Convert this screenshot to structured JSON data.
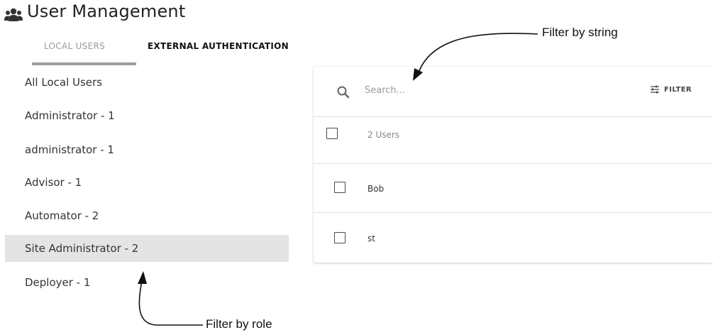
{
  "header": {
    "title": "User Management",
    "icon": "users-icon"
  },
  "tabs": [
    {
      "label": "LOCAL USERS",
      "active": true
    },
    {
      "label": "EXTERNAL AUTHENTICATION",
      "active": false
    }
  ],
  "roles": [
    {
      "label": "All Local Users",
      "selected": false
    },
    {
      "label": "Administrator - 1",
      "selected": false
    },
    {
      "label": "administrator - 1",
      "selected": false
    },
    {
      "label": "Advisor - 1",
      "selected": false
    },
    {
      "label": "Automator - 2",
      "selected": false
    },
    {
      "label": "Site Administrator - 2",
      "selected": true
    },
    {
      "label": "Deployer - 1",
      "selected": false
    }
  ],
  "toolbar": {
    "search_placeholder": "Search...",
    "filter_label": "FILTER",
    "filter_icon": "sliders-icon",
    "search_icon": "search-icon"
  },
  "users": {
    "count_label": "2 Users",
    "rows": [
      {
        "name": "Bob"
      },
      {
        "name": "st"
      }
    ]
  },
  "annotations": {
    "string_filter": "Filter by string",
    "role_filter": "Filter by role"
  },
  "colors": {
    "selected_row": "#e4e4e4",
    "tab_underline": "#9e9e9e",
    "text": "#333333"
  }
}
